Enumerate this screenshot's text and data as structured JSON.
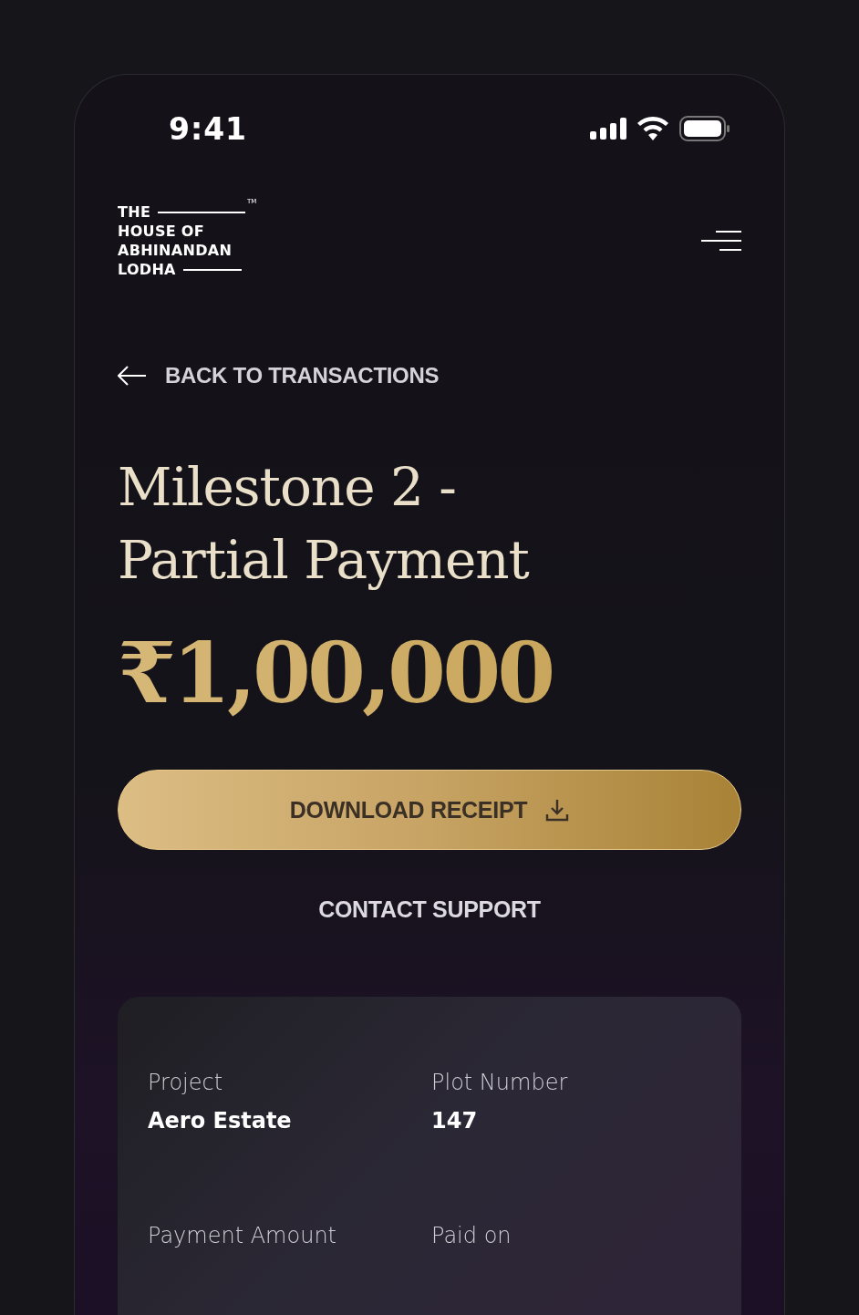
{
  "status_bar": {
    "time": "9:41"
  },
  "logo": {
    "lines": [
      "THE",
      "HOUSE OF",
      "ABHINANDAN",
      "LODHA"
    ],
    "mark": "TM"
  },
  "back_link": {
    "label": "BACK TO TRANSACTIONS"
  },
  "title": "Milestone 2 - Partial Payment",
  "amount": "₹1,00,000",
  "buttons": [
    {
      "label": "DOWNLOAD RECEIPT",
      "kind": "primary"
    },
    {
      "label": "CONTACT SUPPORT",
      "kind": "text"
    }
  ],
  "details": [
    {
      "label": "Project",
      "value": "Aero Estate"
    },
    {
      "label": "Plot Number",
      "value": "147"
    },
    {
      "label": "Payment Amount"
    },
    {
      "label": "Paid on"
    }
  ]
}
